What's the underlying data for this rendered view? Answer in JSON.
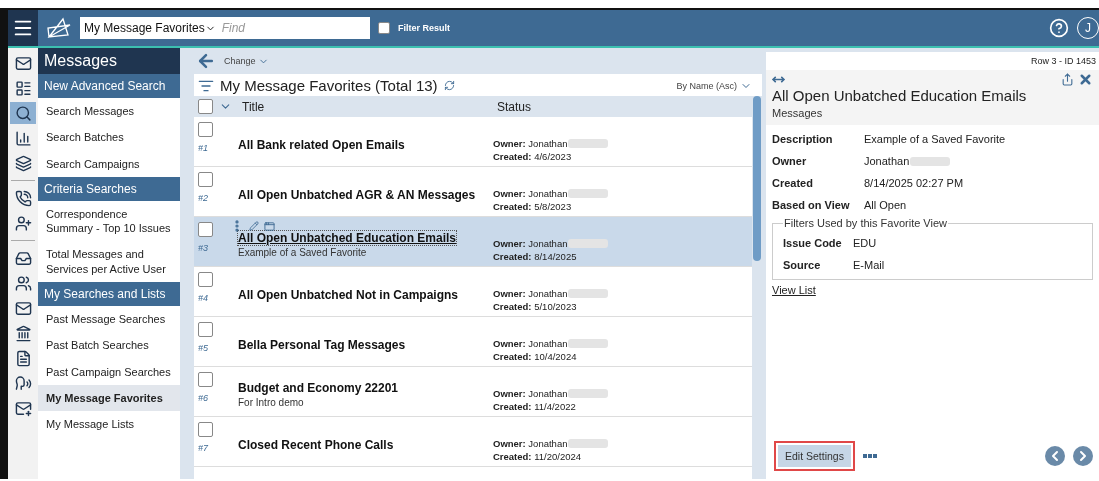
{
  "top_bar": {
    "view_select": "My Message Favorites",
    "search": {
      "placeholder": "Find"
    },
    "filter_result": {
      "label": "Filter Result",
      "checked": false
    },
    "avatar": "J"
  },
  "rail": [
    {
      "selected": false
    },
    {
      "selected": false
    },
    {
      "selected": true
    },
    {
      "selected": false
    },
    {
      "selected": false
    },
    {
      "selected": false
    },
    {
      "selected": false
    },
    {
      "selected": false
    },
    {
      "selected": false
    },
    {
      "selected": false
    },
    {
      "selected": false
    },
    {
      "selected": false
    },
    {
      "selected": false
    },
    {
      "selected": false
    }
  ],
  "sidebar": {
    "title": "Messages",
    "groups": [
      {
        "header": "New Advanced Search",
        "items": [
          {
            "label": "Search Messages",
            "selected": false
          },
          {
            "label": "Search Batches",
            "selected": false
          },
          {
            "label": "Search Campaigns",
            "selected": false
          }
        ]
      },
      {
        "header": "Criteria Searches",
        "items": [
          {
            "label": "Correspondence Summary - Top 10 Issues",
            "selected": false
          },
          {
            "label": "Total Messages and Services per Active User",
            "selected": false
          }
        ]
      },
      {
        "header": "My Searches and Lists",
        "items": [
          {
            "label": "Past Message Searches",
            "selected": false
          },
          {
            "label": "Past Batch Searches",
            "selected": false
          },
          {
            "label": "Past Campaign Searches",
            "selected": false
          },
          {
            "label": "My Message Favorites",
            "selected": true
          },
          {
            "label": "My Message Lists",
            "selected": false
          }
        ]
      }
    ]
  },
  "list": {
    "change": "Change",
    "title": "My Message Favorites (Total 13)",
    "sort": "By Name (Asc)",
    "all_checked": false,
    "columns": [
      "Title",
      "Status"
    ],
    "rows": [
      {
        "number": "#1",
        "title": "All Bank related Open Emails",
        "description": null,
        "owner": "**Owner:** Jonathan",
        "created": "**Created:** 4/6/2023",
        "selected": false,
        "checked": false
      },
      {
        "number": "#2",
        "title": "All Open Unbatched AGR & AN Messages",
        "description": null,
        "owner": "**Owner:** Jonathan",
        "created": "**Created:** 5/8/2023",
        "selected": false,
        "checked": false
      },
      {
        "number": "#3",
        "title": "All Open Unbatched Education Emails",
        "description": "Example of a Saved Favorite",
        "owner": "**Owner:** Jonathan",
        "created": "**Created:** 8/14/2025",
        "selected": true,
        "checked": false
      },
      {
        "number": "#4",
        "title": "All Open Unbatched Not in Campaigns",
        "description": null,
        "owner": "**Owner:** Jonathan",
        "created": "**Created:** 5/10/2023",
        "selected": false,
        "checked": false
      },
      {
        "number": "#5",
        "title": "Bella Personal Tag Messages",
        "description": null,
        "owner": "**Owner:** Jonathan",
        "created": "**Created:** 10/4/2024",
        "selected": false,
        "checked": false
      },
      {
        "number": "#6",
        "title": "Budget and Economy 22201",
        "description": "For Intro demo",
        "owner": "**Owner:** Jonathan",
        "created": "**Created:** 11/4/2022",
        "selected": false,
        "checked": false
      },
      {
        "number": "#7",
        "title": "Closed Recent Phone Calls",
        "description": null,
        "owner": "**Owner:** Jonathan",
        "created": "**Created:** 11/20/2024",
        "selected": false,
        "checked": false
      }
    ]
  },
  "detail": {
    "row_id": "Row 3 - ID 1453",
    "title": "All Open Unbatched Education Emails",
    "subtitle": "Messages",
    "fields": [
      {
        "label": "Description",
        "value": "Example of a Saved Favorite",
        "redacted": false
      },
      {
        "label": "Owner",
        "value": "Jonathan",
        "redacted": true
      },
      {
        "label": "Created",
        "value": "8/14/2025 02:27 PM",
        "redacted": false
      },
      {
        "label": "Based on View",
        "value": "All Open",
        "redacted": false
      }
    ],
    "filters": {
      "legend": "Filters Used by this Favorite View",
      "fields": [
        {
          "label": "Issue Code",
          "value": "EDU"
        },
        {
          "label": "Source",
          "value": "E-Mail"
        }
      ]
    },
    "link": "View List",
    "button": {
      "label": "Edit Settings",
      "highlighted": true
    }
  }
}
